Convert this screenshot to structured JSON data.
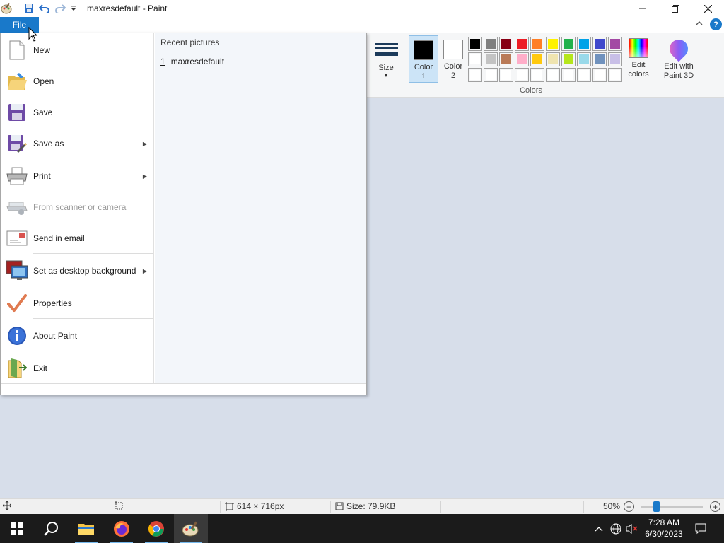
{
  "window": {
    "title": "maxresdefault - Paint",
    "minimize_icon": "minimize-icon",
    "restore_icon": "restore-icon",
    "close_icon": "close-icon"
  },
  "quick_access": [
    "paint-app-icon",
    "save-icon",
    "undo-icon",
    "redo-icon",
    "customize-dropdown-icon"
  ],
  "ribbon": {
    "file_tab": "File",
    "help": "?",
    "size_label": "Size",
    "color1": {
      "line1": "Color",
      "line2": "1",
      "value": "#000000"
    },
    "color2": {
      "line1": "Color",
      "line2": "2",
      "value": "#ffffff"
    },
    "palette": [
      [
        "#000000",
        "#7f7f7f",
        "#880015",
        "#ed1c24",
        "#ff7f27",
        "#fff200",
        "#22b14c",
        "#00a2e8",
        "#3f48cc",
        "#a349a4"
      ],
      [
        "#ffffff",
        "#c3c3c3",
        "#b97a57",
        "#ffaec9",
        "#ffc90e",
        "#efe4b0",
        "#b5e61d",
        "#99d9ea",
        "#7092be",
        "#c8bfe7"
      ],
      [
        "",
        "",
        "",
        "",
        "",
        "",
        "",
        "",
        "",
        ""
      ]
    ],
    "colors_group": "Colors",
    "edit_colors": {
      "line1": "Edit",
      "line2": "colors"
    },
    "paint3d": {
      "line1": "Edit with",
      "line2": "Paint 3D"
    }
  },
  "file_menu": {
    "items": [
      {
        "label": "New",
        "icon": "new-document-icon",
        "submenu": false,
        "disabled": false
      },
      {
        "label": "Open",
        "icon": "open-folder-icon",
        "submenu": false,
        "disabled": false
      },
      {
        "label": "Save",
        "icon": "save-disk-icon",
        "submenu": false,
        "disabled": false
      },
      {
        "label": "Save as",
        "icon": "save-as-icon",
        "submenu": true,
        "disabled": false
      },
      {
        "label": "Print",
        "icon": "printer-icon",
        "submenu": true,
        "disabled": false
      },
      {
        "label": "From scanner or camera",
        "icon": "scanner-icon",
        "submenu": false,
        "disabled": true
      },
      {
        "label": "Send in email",
        "icon": "email-icon",
        "submenu": false,
        "disabled": false
      },
      {
        "label": "Set as desktop background",
        "icon": "desktop-background-icon",
        "submenu": true,
        "disabled": false
      },
      {
        "label": "Properties",
        "icon": "checkmark-icon",
        "submenu": false,
        "disabled": false
      },
      {
        "label": "About Paint",
        "icon": "info-icon",
        "submenu": false,
        "disabled": false
      },
      {
        "label": "Exit",
        "icon": "exit-icon",
        "submenu": false,
        "disabled": false
      }
    ],
    "recent_header": "Recent pictures",
    "recent": [
      {
        "num": "1",
        "name": "maxresdefault"
      }
    ]
  },
  "statusbar": {
    "dimensions": "614 × 716px",
    "size": "Size: 79.9KB",
    "zoom": "50%",
    "zoom_level_percent": 50
  },
  "taskbar": {
    "apps": [
      "start-icon",
      "search-icon",
      "file-explorer-icon",
      "firefox-icon",
      "chrome-icon",
      "paint-icon"
    ],
    "time": "7:28 AM",
    "date": "6/30/2023"
  }
}
